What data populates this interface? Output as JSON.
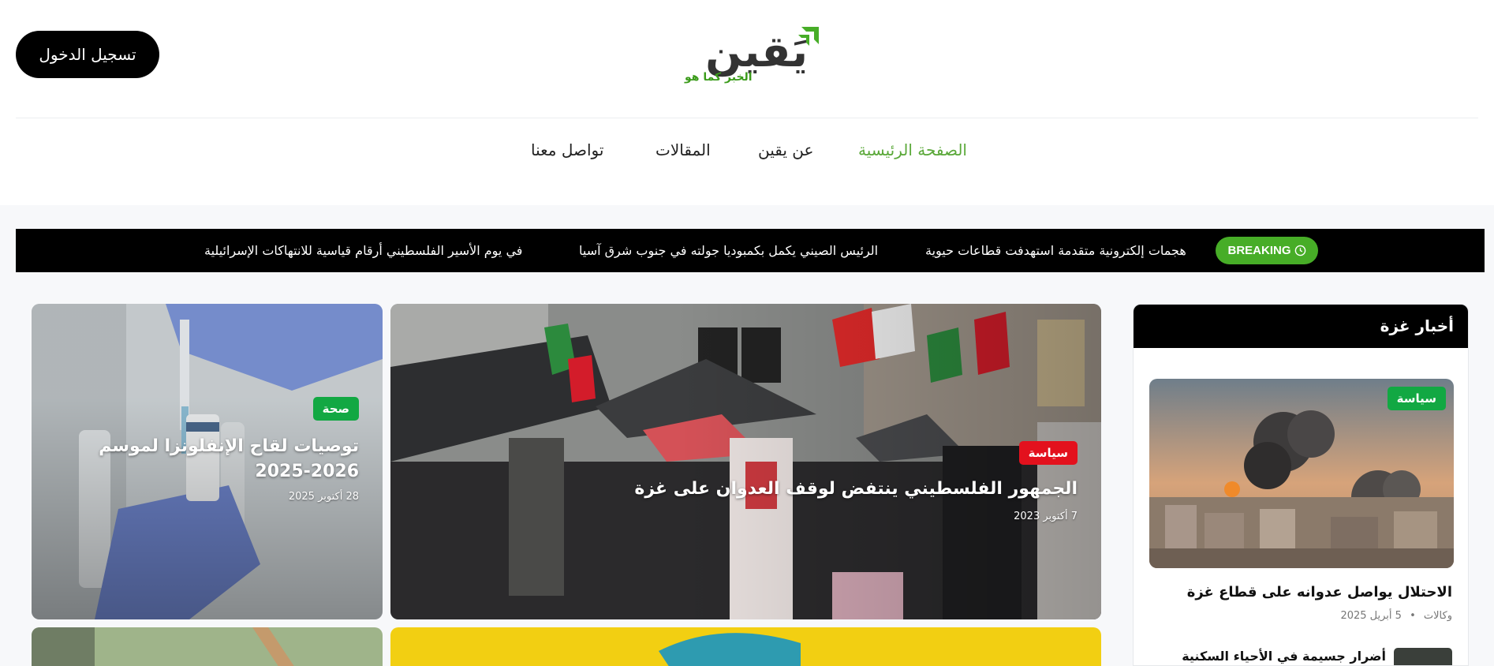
{
  "header": {
    "login_label": "تسجيل الدخول",
    "logo_text": "يَقين",
    "logo_tagline": "الخبر كما هو"
  },
  "nav": {
    "items": [
      {
        "label": "الصفحة الرئيسية",
        "active": true
      },
      {
        "label": "عن يقين",
        "active": false
      },
      {
        "label": "المقالات",
        "active": false
      },
      {
        "label": "تواصل معنا",
        "active": false
      }
    ]
  },
  "ticker": {
    "badge": "BREAKING",
    "items": [
      "هجمات إلكترونية متقدمة استهدفت قطاعات حيوية",
      "الرئيس الصيني يكمل بكمبوديا جولته في جنوب شرق آسيا",
      "في يوم الأسير الفلسطيني أرقام قياسية للانتهاكات الإسرائيلية"
    ]
  },
  "featured": {
    "main": {
      "category": "سياسة",
      "title": "الجمهور الفلسطيني ينتفض لوقف العدوان على غزة",
      "date": "7 أكتوبر 2023"
    },
    "side": {
      "category": "صحة",
      "title_line1": "توصيات لقاح الإنفلونزا لموسم",
      "title_line2": "2025-2026",
      "date": "28 أكتوبر 2025"
    }
  },
  "sidebar": {
    "title": "أخبار غزة",
    "top_item": {
      "category": "سياسة",
      "headline": "الاحتلال يواصل عدوانه على قطاع غزة",
      "source": "وكالات",
      "separator": "•",
      "date": "5 أبريل 2025"
    },
    "second_item": {
      "headline": "أضرار جسيمة في الأحياء السكنية"
    }
  },
  "colors": {
    "brand_green": "#47ad27",
    "nav_active": "#5aa839",
    "politics_badge_red": "#e3111d",
    "badge_green": "#12a843",
    "ticker_bg": "#000000"
  },
  "icons": [
    "clock-icon",
    "logo-arrow-icon"
  ]
}
